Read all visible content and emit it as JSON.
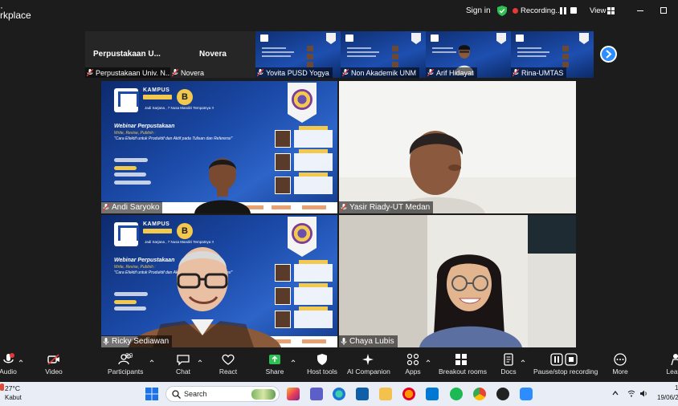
{
  "window": {
    "app_name_line1": "·",
    "app_name_line2": "rkplace",
    "sign_in": "Sign in",
    "recording_label": "Recording...",
    "view_label": "View"
  },
  "filmstrip": [
    {
      "name": "Perpustakaan Univ. N...",
      "display": "Perpustakaan  U...",
      "video": false
    },
    {
      "name": "Novera",
      "display": "Novera",
      "video": false
    },
    {
      "name": "Yovita PUSD Yogya",
      "video": true
    },
    {
      "name": "Non Akademik UNM",
      "video": true
    },
    {
      "name": "Arif Hidayat",
      "video": true
    },
    {
      "name": "Rina-UMTAS",
      "video": true
    }
  ],
  "gallery": [
    {
      "name": "Andi Saryoko",
      "muted": true,
      "active": false
    },
    {
      "name": "Yasir Riady-UT Medan",
      "muted": true,
      "active": false
    },
    {
      "name": "Ricky Sediawan",
      "muted": false,
      "active": true
    },
    {
      "name": "Chaya Lubis",
      "muted": false,
      "active": false
    }
  ],
  "slide": {
    "kampus": "KAMPUS",
    "badge_letter": "B",
    "tagline": "Jadi Sarjana , 7 Nusa Mandiri Tempatnya !!",
    "webinar": "Webinar Perpustakaan",
    "subtitle": "Write, Revise, Publish :",
    "topic": "\"Cara Efektif untuk Produktif dan Aktif pada Tulisan dan Referensi\""
  },
  "toolbar": {
    "audio": "Audio",
    "video": "Video",
    "participants": "Participants",
    "participants_count": "99",
    "chat": "Chat",
    "react": "React",
    "share": "Share",
    "host_tools": "Host tools",
    "ai_companion": "AI Companion",
    "apps": "Apps",
    "breakout_rooms": "Breakout rooms",
    "docs": "Docs",
    "pause_stop_recording": "Pause/stop recording",
    "more": "More",
    "leave": "Leave"
  },
  "taskbar": {
    "temperature": "27°C",
    "weather": "Kabut",
    "search_label": "Search",
    "time": "1",
    "date": "19/06/2"
  },
  "colors": {
    "accent_blue": "#2d8cff",
    "active_speaker_green": "#3fd46c",
    "recording_red": "#e53935",
    "share_green": "#2fbf53"
  }
}
